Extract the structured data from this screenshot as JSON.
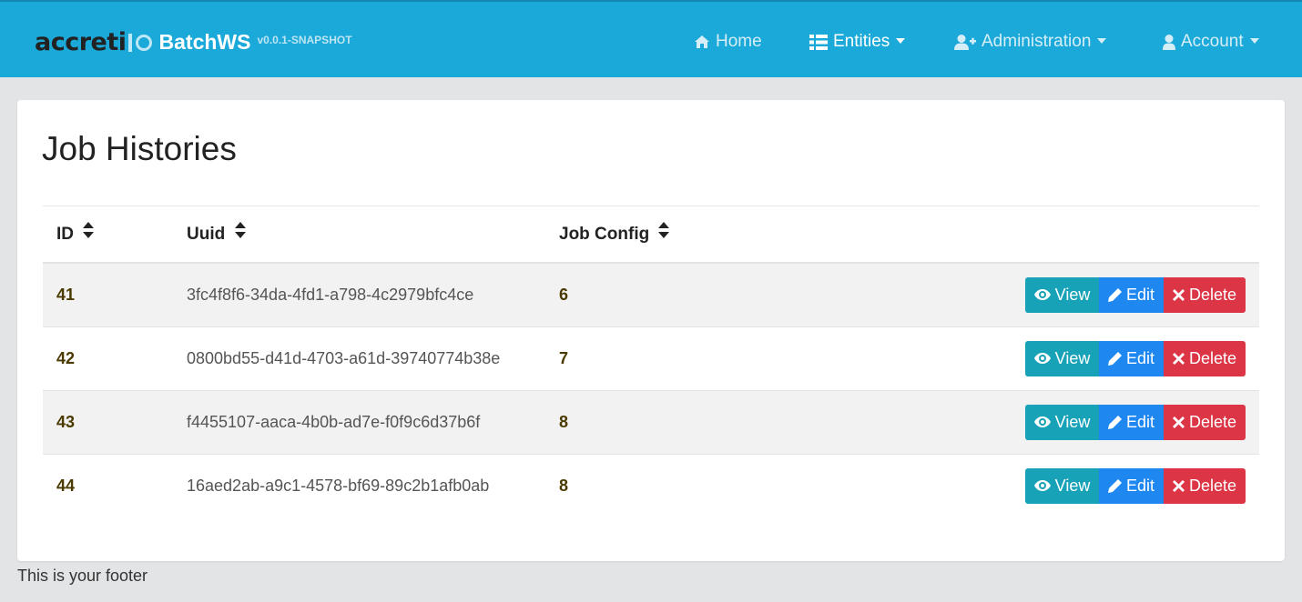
{
  "brand": {
    "logo_text": "accreti",
    "name": "BatchWS",
    "version": "v0.0.1-SNAPSHOT"
  },
  "nav": {
    "home": {
      "label": "Home",
      "icon": "home-icon"
    },
    "entities": {
      "label": "Entities",
      "icon": "th-list-icon"
    },
    "administration": {
      "label": "Administration",
      "icon": "user-plus-icon"
    },
    "account": {
      "label": "Account",
      "icon": "user-icon"
    }
  },
  "page": {
    "title": "Job Histories"
  },
  "table": {
    "columns": [
      {
        "label": "ID"
      },
      {
        "label": "Uuid"
      },
      {
        "label": "Job Config"
      }
    ],
    "rows": [
      {
        "id": "41",
        "uuid": "3fc4f8f6-34da-4fd1-a798-4c2979bfc4ce",
        "job_config": "6"
      },
      {
        "id": "42",
        "uuid": "0800bd55-d41d-4703-a61d-39740774b38e",
        "job_config": "7"
      },
      {
        "id": "43",
        "uuid": "f4455107-aaca-4b0b-ad7e-f0f9c6d37b6f",
        "job_config": "8"
      },
      {
        "id": "44",
        "uuid": "16aed2ab-a9c1-4578-bf69-89c2b1afb0ab",
        "job_config": "8"
      }
    ],
    "actions": {
      "view": "View",
      "edit": "Edit",
      "delete": "Delete"
    }
  },
  "footer": {
    "text": "This is your footer"
  },
  "colors": {
    "navbar": "#1aa9d9",
    "view_button": "#17a2b8",
    "edit_button": "#1f88f0",
    "delete_button": "#dc3545"
  }
}
